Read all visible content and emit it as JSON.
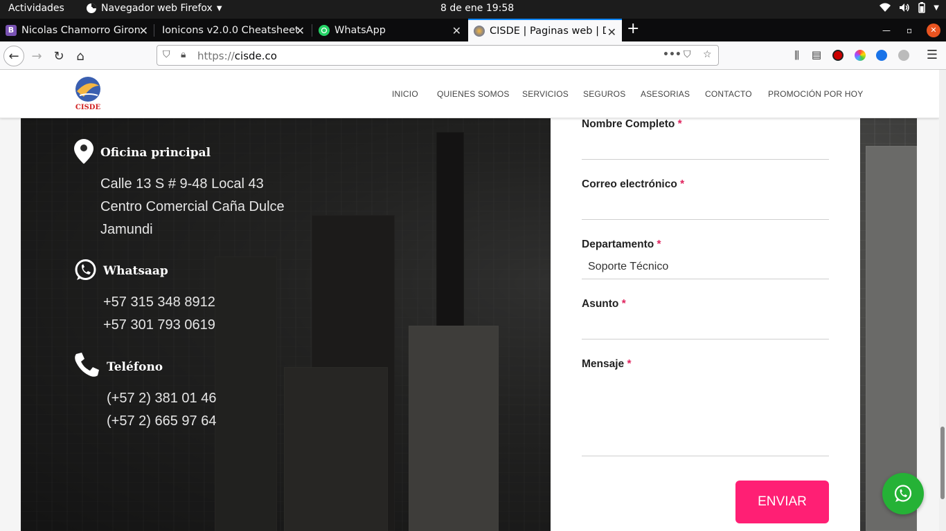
{
  "system": {
    "activities": "Actividades",
    "app_menu": "Navegador web Firefox",
    "clock": "8 de ene  19:58"
  },
  "tabs": [
    {
      "label": "Nicolas Chamorro Giron",
      "icon": "bootstrap-icon",
      "icon_text": "B",
      "color": "#7952b3"
    },
    {
      "label": "Ionicons v2.0.0 Cheatsheet",
      "icon": "none"
    },
    {
      "label": "WhatsApp",
      "icon": "whatsapp-icon",
      "color": "#25d366"
    },
    {
      "label": "CISDE | Paginas web | Dis",
      "icon": "cisde-favicon",
      "active": true
    }
  ],
  "navbar": {
    "url_proto": "https://",
    "url_host": "cisde.co"
  },
  "site": {
    "logo_text": "CISDE",
    "menu": [
      "INICIO",
      "QUIENES SOMOS",
      "SERVICIOS",
      "SEGUROS",
      "ASESORIAS",
      "CONTACTO",
      "PROMOCIÓN POR HOY"
    ]
  },
  "contact": {
    "office": {
      "title": "Oficina principal",
      "lines": [
        "Calle 13 S # 9-48 Local 43",
        "Centro Comercial Caña Dulce",
        "Jamundi"
      ]
    },
    "whatsapp": {
      "title": "Whatsaap",
      "lines": [
        "+57 315 348 8912",
        "+57 301 793 0619"
      ]
    },
    "phone": {
      "title": "Teléfono",
      "lines": [
        "(+57 2) 381 01 46",
        "(+57 2) 665 97 64"
      ]
    }
  },
  "form": {
    "required_mark": "*",
    "name_label": "Nombre Completo",
    "email_label": "Correo electrónico",
    "department_label": "Departamento",
    "department_value": "Soporte Técnico",
    "subject_label": "Asunto",
    "message_label": "Mensaje",
    "submit_label": "ENVIAR"
  },
  "colors": {
    "accent": "#ff1f74",
    "whatsapp": "#25b236",
    "firefox_blue": "#0a84ff"
  }
}
